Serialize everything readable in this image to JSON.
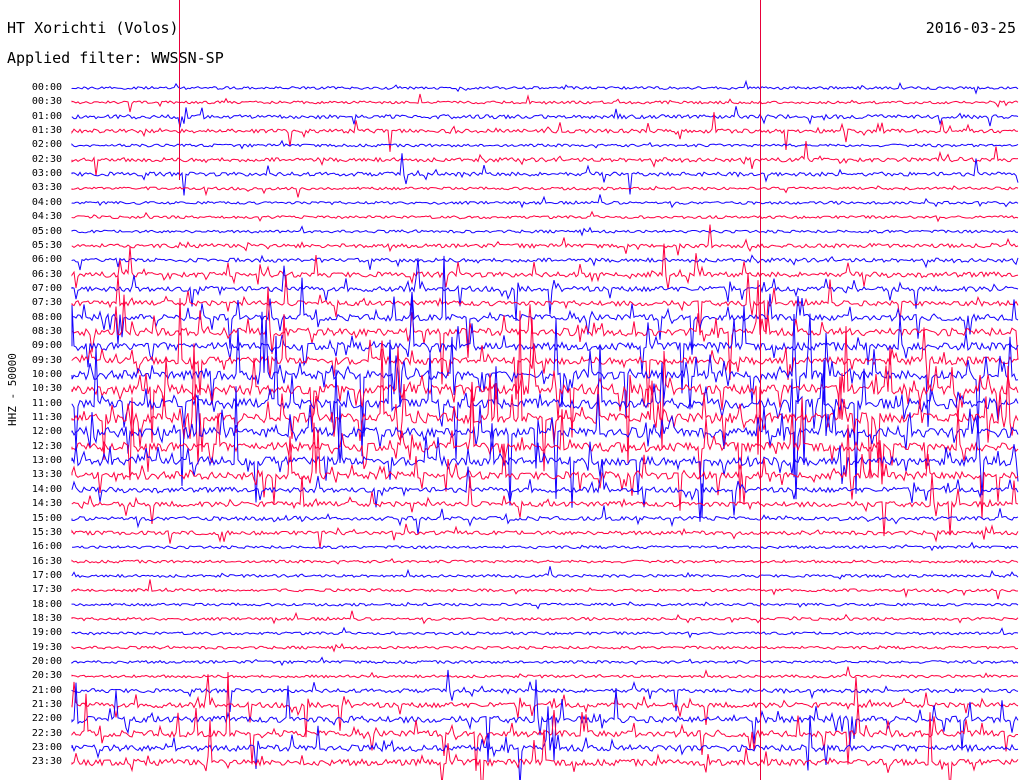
{
  "header": {
    "station": "HT Xorichti (Volos)",
    "date": "2016-03-25",
    "filter": "Applied filter: WWSSN-SP"
  },
  "channel_label": "HHZ - 50000",
  "trace_colors": {
    "even_rows": "#1400ff",
    "odd_rows": "#ff0040"
  },
  "time_labels": [
    "00:00",
    "00:30",
    "01:00",
    "01:30",
    "02:00",
    "02:30",
    "03:00",
    "03:30",
    "04:00",
    "04:30",
    "05:00",
    "05:30",
    "06:00",
    "06:30",
    "07:00",
    "07:30",
    "08:00",
    "08:30",
    "09:00",
    "09:30",
    "10:00",
    "10:30",
    "11:00",
    "11:30",
    "12:00",
    "12:30",
    "13:00",
    "13:30",
    "14:00",
    "14:30",
    "15:00",
    "15:30",
    "16:00",
    "16:30",
    "17:00",
    "17:30",
    "18:00",
    "18:30",
    "19:00",
    "19:30",
    "20:00",
    "20:30",
    "21:00",
    "21:30",
    "22:00",
    "22:30",
    "23:00",
    "23:30"
  ],
  "activity": [
    1,
    1,
    2,
    2,
    1,
    2,
    2,
    1,
    1,
    1,
    1,
    2,
    2,
    3,
    3,
    3,
    4,
    5,
    5,
    5,
    6,
    7,
    7,
    7,
    7,
    6,
    6,
    5,
    3,
    3,
    2,
    2,
    1,
    1,
    1,
    1,
    1,
    1,
    1,
    1,
    1,
    1,
    2,
    3,
    4,
    4,
    4,
    4
  ]
}
